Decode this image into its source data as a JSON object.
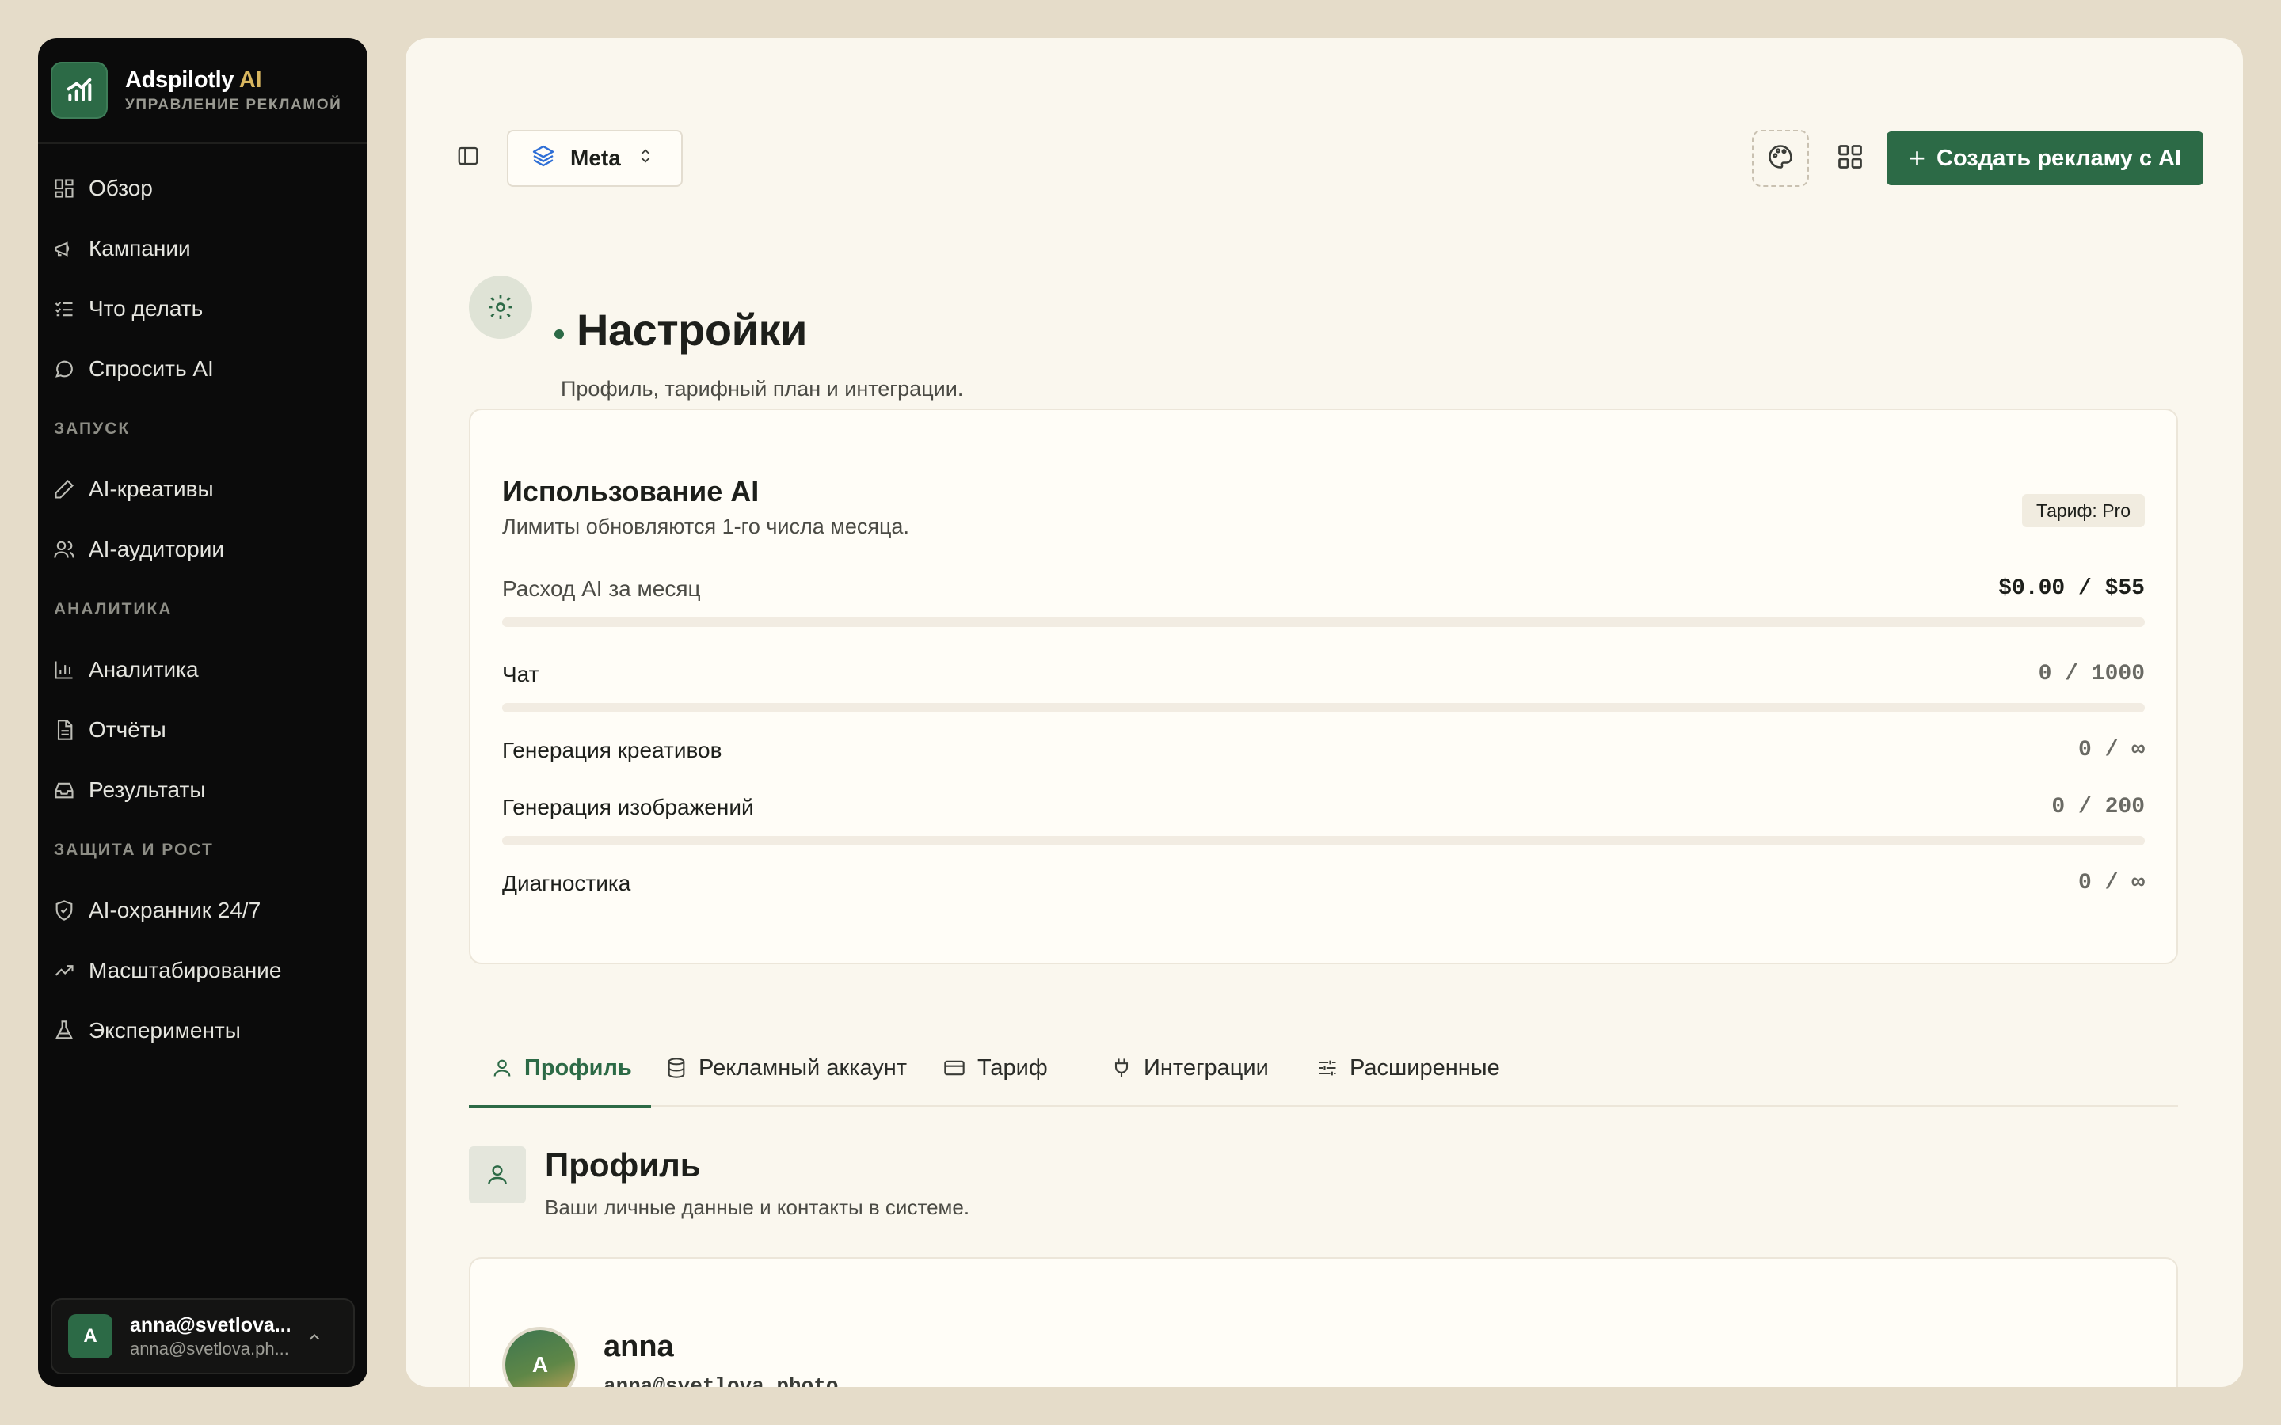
{
  "brand": {
    "name": "Adspilotly",
    "name_ai": "AI",
    "subtitle": "УПРАВЛЕНИЕ РЕКЛАМОЙ"
  },
  "sidebar": {
    "items_main": [
      {
        "label": "Обзор",
        "icon": "dashboard-icon"
      },
      {
        "label": "Кампании",
        "icon": "megaphone-icon"
      },
      {
        "label": "Что делать",
        "icon": "checklist-icon"
      },
      {
        "label": "Спросить AI",
        "icon": "chat-bubble-icon"
      }
    ],
    "section_launch": "ЗАПУСК",
    "items_launch": [
      {
        "label": "AI-креативы",
        "icon": "pen-icon"
      },
      {
        "label": "AI-аудитории",
        "icon": "users-icon"
      }
    ],
    "section_analytics": "АНАЛИТИКА",
    "items_analytics": [
      {
        "label": "Аналитика",
        "icon": "bar-chart-icon"
      },
      {
        "label": "Отчёты",
        "icon": "document-icon"
      },
      {
        "label": "Результаты",
        "icon": "inbox-icon"
      }
    ],
    "section_growth": "ЗАЩИТА И РОСТ",
    "items_growth": [
      {
        "label": "AI-охранник 24/7",
        "icon": "shield-icon"
      },
      {
        "label": "Масштабирование",
        "icon": "trend-up-icon"
      },
      {
        "label": "Эксперименты",
        "icon": "flask-icon"
      }
    ],
    "user": {
      "initial": "A",
      "name": "anna@svetlova...",
      "email": "anna@svetlova.ph..."
    }
  },
  "topbar": {
    "platform": "Meta",
    "create_label": "Создать рекламу с AI"
  },
  "page": {
    "title": "Настройки",
    "subtitle": "Профиль, тарифный план и интеграции."
  },
  "usage": {
    "title": "Использование AI",
    "subtitle": "Лимиты обновляются 1-го числа месяца.",
    "plan_badge": "Тариф: Pro",
    "rows": [
      {
        "label": "Расход AI за месяц",
        "value": "$0.00 / $55",
        "fraction": 0
      },
      {
        "label": "Чат",
        "value": "0 / 1000",
        "fraction": 0
      },
      {
        "label": "Генерация креативов",
        "value": "0 / ∞"
      },
      {
        "label": "Генерация изображений",
        "value": "0 / 200",
        "fraction": 0
      },
      {
        "label": "Диагностика",
        "value": "0 / ∞"
      }
    ]
  },
  "tabs": [
    {
      "label": "Профиль",
      "icon": "user-icon",
      "active": true
    },
    {
      "label": "Рекламный аккаунт",
      "icon": "database-icon"
    },
    {
      "label": "Тариф",
      "icon": "credit-card-icon"
    },
    {
      "label": "Интеграции",
      "icon": "plug-icon"
    },
    {
      "label": "Расширенные",
      "icon": "sliders-icon"
    }
  ],
  "profile": {
    "title": "Профиль",
    "subtitle": "Ваши личные данные и контакты в системе.",
    "initial": "A",
    "name": "anna",
    "email": "anna@svetlova.photo"
  },
  "colors": {
    "accent": "#2c6a46",
    "background": "#e5dcc9",
    "sidebar": "#0b0b0b",
    "surface": "#faf7ee"
  }
}
